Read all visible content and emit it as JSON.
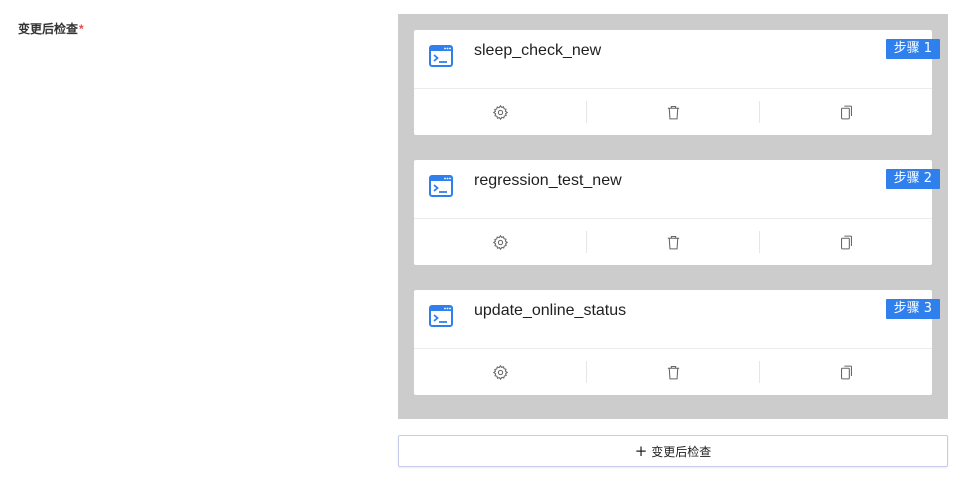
{
  "field": {
    "label": "变更后检查",
    "required_mark": "*"
  },
  "steps": [
    {
      "name": "sleep_check_new",
      "badge": "步骤 1",
      "icon": "terminal-icon"
    },
    {
      "name": "regression_test_new",
      "badge": "步骤 2",
      "icon": "terminal-icon"
    },
    {
      "name": "update_online_status",
      "badge": "步骤 3",
      "icon": "terminal-icon"
    }
  ],
  "actions": [
    "gear-icon",
    "trash-icon",
    "copy-icon"
  ],
  "add_button": {
    "plus": "+",
    "label": "变更后检查"
  },
  "colors": {
    "accent": "#2f80ed",
    "container_bg": "#cccccc",
    "required": "#e5484d"
  }
}
